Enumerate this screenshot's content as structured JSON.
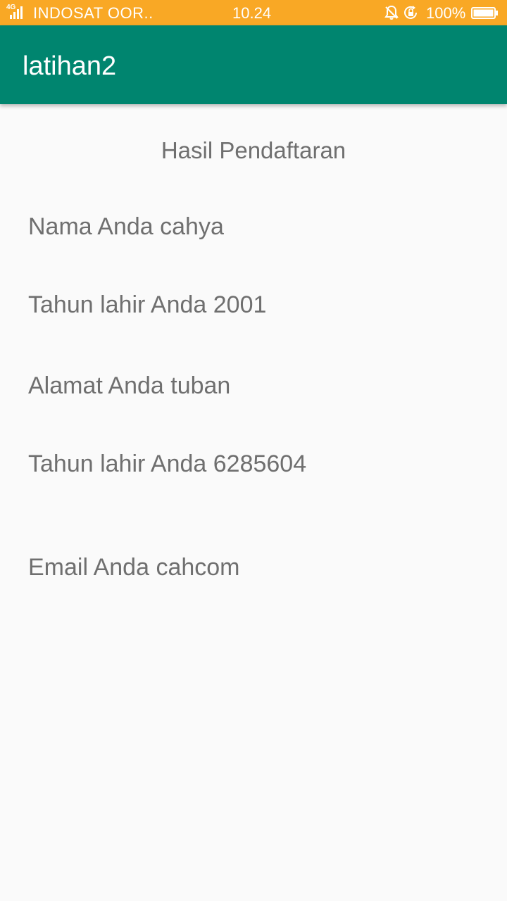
{
  "status_bar": {
    "network": "4G",
    "carrier": "INDOSAT OOR..",
    "time": "10.24",
    "battery": "100%",
    "icons": [
      "signal-icon",
      "bell-off-icon",
      "rotation-lock-icon",
      "battery-icon"
    ]
  },
  "app_bar": {
    "title": "latihan2",
    "color": "#00856F"
  },
  "result": {
    "heading": "Hasil Pendaftaran",
    "rows": [
      {
        "label": "Nama Anda",
        "value": "cahya"
      },
      {
        "label": "Tahun lahir Anda",
        "value": "2001"
      },
      {
        "label": "Alamat Anda",
        "value": "tuban"
      },
      {
        "label": "Tahun lahir Anda",
        "value": "6285604"
      },
      {
        "label": "Email Anda",
        "value": "cahcom"
      }
    ]
  }
}
